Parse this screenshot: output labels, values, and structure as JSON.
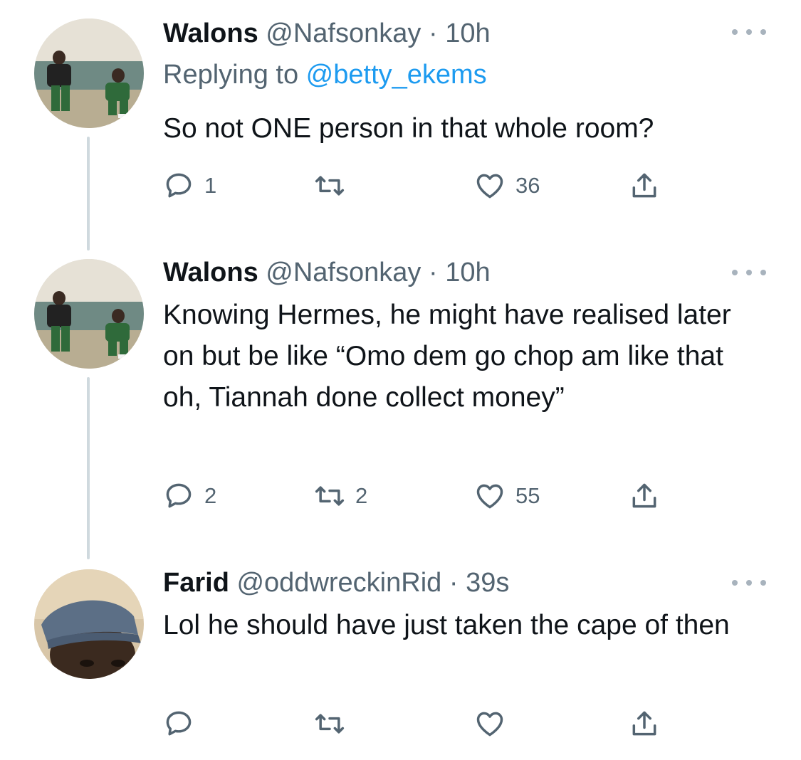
{
  "tweets": [
    {
      "name": "Walons",
      "handle": "@Nafsonkay",
      "separator": " · ",
      "time": "10h",
      "replying_label": "Replying to ",
      "replying_handle": "@betty_ekems",
      "text": "So not ONE person in that whole room?",
      "reply_count": "1",
      "retweet_count": "",
      "like_count": "36",
      "avatar": "avatar-two-men-on-couch"
    },
    {
      "name": "Walons",
      "handle": "@Nafsonkay",
      "separator": " · ",
      "time": "10h",
      "text": "Knowing Hermes, he might have realised later on but be like “Omo dem go chop am like that oh, Tiannah done collect money”",
      "reply_count": "2",
      "retweet_count": "2",
      "like_count": "55",
      "avatar": "avatar-two-men-on-couch"
    },
    {
      "name": "Farid",
      "handle": "@oddwreckinRid",
      "separator": " · ",
      "time": "39s",
      "text": "Lol he should have just taken the cape of then",
      "reply_count": "",
      "retweet_count": "",
      "like_count": "",
      "avatar": "avatar-man-in-cap"
    }
  ],
  "icons": {
    "reply": "speech-bubble-icon",
    "retweet": "retweet-arrows-icon",
    "like": "heart-icon",
    "share": "share-upload-icon",
    "more": "more-dots-icon"
  },
  "colors": {
    "text": "#0f1419",
    "secondary": "#536471",
    "link": "#1d9bf0",
    "thread_line": "#cfd9de"
  }
}
